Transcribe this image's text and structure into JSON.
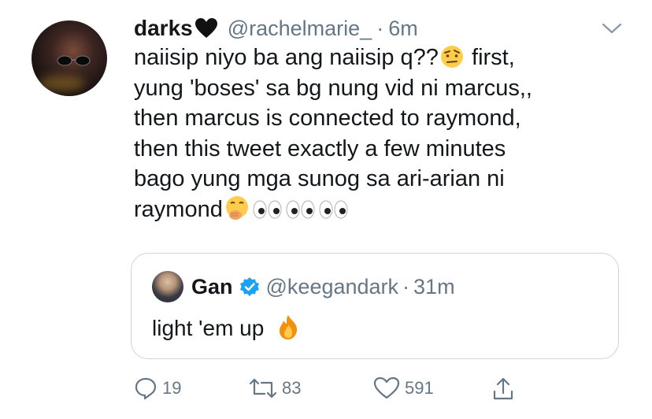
{
  "tweet": {
    "display_name": "darks",
    "name_emoji": "black-heart-icon",
    "handle": "@rachelmarie_",
    "separator": "·",
    "time": "6m",
    "text_lines": [
      "naiisip niyo ba ang naiisip q??",
      " first,",
      "yung 'boses' sa bg nung vid ni marcus,,",
      "then marcus is connected to raymond,",
      "then this tweet exactly a few minutes",
      "bago yung mga sunog sa ari-arian ni",
      "raymond"
    ]
  },
  "quoted_tweet": {
    "display_name": "Gan",
    "handle": "@keegandark",
    "separator": "·",
    "time": "31m",
    "text": "light 'em up"
  },
  "actions": {
    "replies": "19",
    "retweets": "83",
    "likes": "591"
  },
  "colors": {
    "text": "#14171a",
    "secondary": "#657786",
    "border": "#ccd6dd",
    "verified": "#1da1f2"
  }
}
